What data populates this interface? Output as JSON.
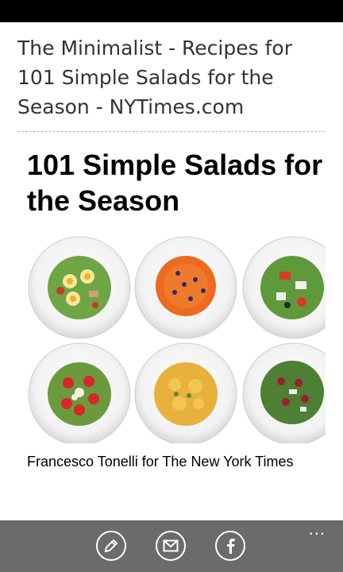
{
  "page": {
    "title": "The Minimalist - Recipes for 101 Simple Salads for the Season - NYTimes.com"
  },
  "article": {
    "headline": "101 Simple Salads for the Season",
    "photo_credit": "Francesco Tonelli for The New York Times"
  },
  "app_bar": {
    "buttons": [
      {
        "icon": "pencil-icon"
      },
      {
        "icon": "mail-icon"
      },
      {
        "icon": "facebook-icon"
      }
    ],
    "more": "..."
  },
  "colors": {
    "status_bar": "#000000",
    "app_bar": "#6b6b6b",
    "title_text": "#333333"
  }
}
